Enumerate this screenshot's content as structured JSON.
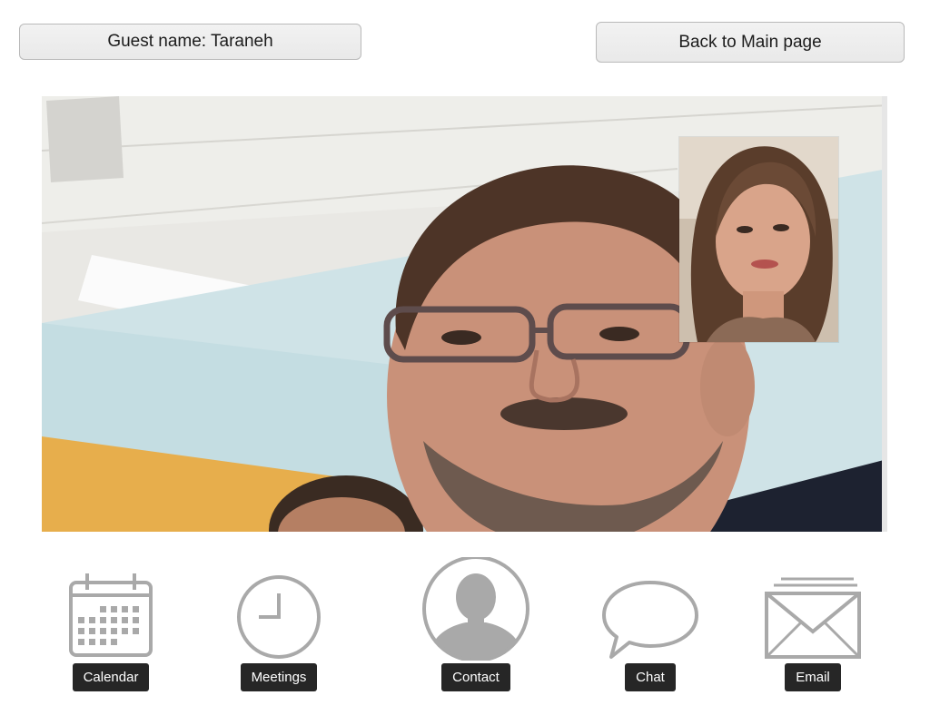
{
  "header": {
    "guest_name": "Guest name: Taraneh",
    "back_button": "Back to Main page"
  },
  "video": {
    "main_feed_icon": "main-video-feed",
    "self_view_icon": "self-view-feed"
  },
  "nav": {
    "items": [
      {
        "label": "Calendar",
        "icon": "calendar-icon"
      },
      {
        "label": "Meetings",
        "icon": "clock-icon"
      },
      {
        "label": "Contact",
        "icon": "person-icon"
      },
      {
        "label": "Chat",
        "icon": "chat-bubble-icon"
      },
      {
        "label": "Email",
        "icon": "envelope-icon"
      }
    ]
  },
  "colors": {
    "icon_gray": "#a9a9a9",
    "label_bg": "#262626",
    "button_border": "#b9b9b9"
  }
}
